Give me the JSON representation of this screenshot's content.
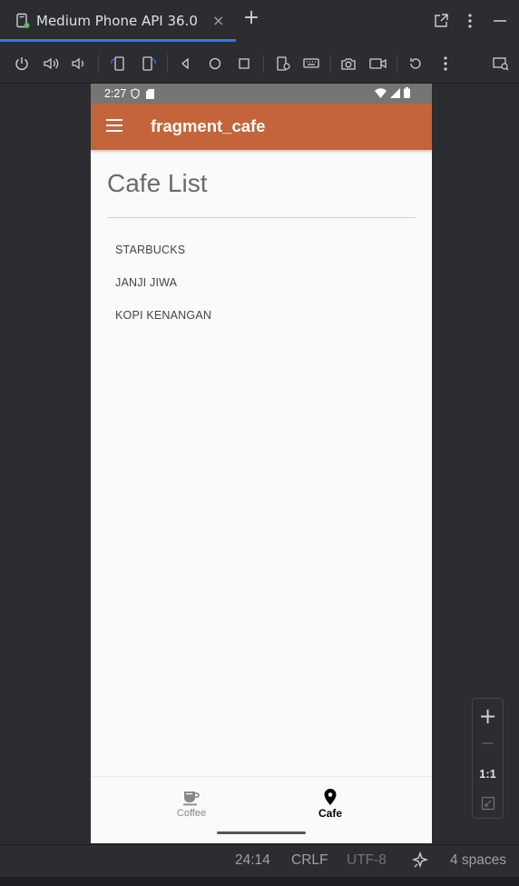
{
  "ide": {
    "tab_title": "Medium Phone API 36.0",
    "tab_close": "×",
    "add_tab": "+"
  },
  "device": {
    "status_time": "2:27",
    "app_bar_title": "fragment_cafe",
    "page_title": "Cafe List",
    "cafes": [
      "STARBUCKS",
      "JANJI JIWA",
      "KOPI KENANGAN"
    ],
    "bottom_nav": {
      "coffee_label": "Coffee",
      "cafe_label": "Cafe",
      "selected": "Cafe"
    }
  },
  "zoom": {
    "plus": "+",
    "minus": "—",
    "ratio": "1:1"
  },
  "statusbar": {
    "position": "24:14",
    "line_sep": "CRLF",
    "encoding": "UTF-8",
    "indent": "4 spaces"
  },
  "colors": {
    "app_bar": "#c4643a",
    "accent": "#3574f0",
    "ide_bg": "#2b2d30"
  }
}
